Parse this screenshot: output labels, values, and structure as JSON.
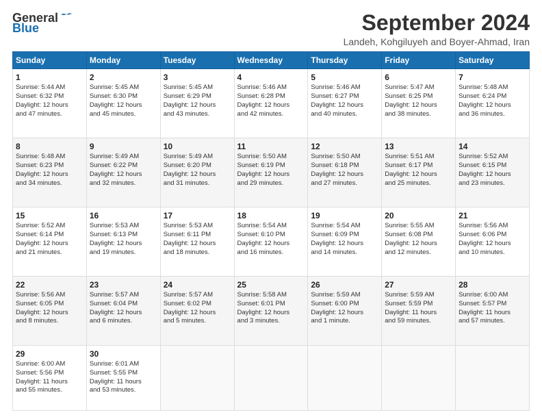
{
  "header": {
    "logo_line1": "General",
    "logo_line2": "Blue",
    "month": "September 2024",
    "location": "Landeh, Kohgiluyeh and Boyer-Ahmad, Iran"
  },
  "weekdays": [
    "Sunday",
    "Monday",
    "Tuesday",
    "Wednesday",
    "Thursday",
    "Friday",
    "Saturday"
  ],
  "weeks": [
    [
      {
        "day": "1",
        "lines": [
          "Sunrise: 5:44 AM",
          "Sunset: 6:32 PM",
          "Daylight: 12 hours",
          "and 47 minutes."
        ]
      },
      {
        "day": "2",
        "lines": [
          "Sunrise: 5:45 AM",
          "Sunset: 6:30 PM",
          "Daylight: 12 hours",
          "and 45 minutes."
        ]
      },
      {
        "day": "3",
        "lines": [
          "Sunrise: 5:45 AM",
          "Sunset: 6:29 PM",
          "Daylight: 12 hours",
          "and 43 minutes."
        ]
      },
      {
        "day": "4",
        "lines": [
          "Sunrise: 5:46 AM",
          "Sunset: 6:28 PM",
          "Daylight: 12 hours",
          "and 42 minutes."
        ]
      },
      {
        "day": "5",
        "lines": [
          "Sunrise: 5:46 AM",
          "Sunset: 6:27 PM",
          "Daylight: 12 hours",
          "and 40 minutes."
        ]
      },
      {
        "day": "6",
        "lines": [
          "Sunrise: 5:47 AM",
          "Sunset: 6:25 PM",
          "Daylight: 12 hours",
          "and 38 minutes."
        ]
      },
      {
        "day": "7",
        "lines": [
          "Sunrise: 5:48 AM",
          "Sunset: 6:24 PM",
          "Daylight: 12 hours",
          "and 36 minutes."
        ]
      }
    ],
    [
      {
        "day": "8",
        "lines": [
          "Sunrise: 5:48 AM",
          "Sunset: 6:23 PM",
          "Daylight: 12 hours",
          "and 34 minutes."
        ]
      },
      {
        "day": "9",
        "lines": [
          "Sunrise: 5:49 AM",
          "Sunset: 6:22 PM",
          "Daylight: 12 hours",
          "and 32 minutes."
        ]
      },
      {
        "day": "10",
        "lines": [
          "Sunrise: 5:49 AM",
          "Sunset: 6:20 PM",
          "Daylight: 12 hours",
          "and 31 minutes."
        ]
      },
      {
        "day": "11",
        "lines": [
          "Sunrise: 5:50 AM",
          "Sunset: 6:19 PM",
          "Daylight: 12 hours",
          "and 29 minutes."
        ]
      },
      {
        "day": "12",
        "lines": [
          "Sunrise: 5:50 AM",
          "Sunset: 6:18 PM",
          "Daylight: 12 hours",
          "and 27 minutes."
        ]
      },
      {
        "day": "13",
        "lines": [
          "Sunrise: 5:51 AM",
          "Sunset: 6:17 PM",
          "Daylight: 12 hours",
          "and 25 minutes."
        ]
      },
      {
        "day": "14",
        "lines": [
          "Sunrise: 5:52 AM",
          "Sunset: 6:15 PM",
          "Daylight: 12 hours",
          "and 23 minutes."
        ]
      }
    ],
    [
      {
        "day": "15",
        "lines": [
          "Sunrise: 5:52 AM",
          "Sunset: 6:14 PM",
          "Daylight: 12 hours",
          "and 21 minutes."
        ]
      },
      {
        "day": "16",
        "lines": [
          "Sunrise: 5:53 AM",
          "Sunset: 6:13 PM",
          "Daylight: 12 hours",
          "and 19 minutes."
        ]
      },
      {
        "day": "17",
        "lines": [
          "Sunrise: 5:53 AM",
          "Sunset: 6:11 PM",
          "Daylight: 12 hours",
          "and 18 minutes."
        ]
      },
      {
        "day": "18",
        "lines": [
          "Sunrise: 5:54 AM",
          "Sunset: 6:10 PM",
          "Daylight: 12 hours",
          "and 16 minutes."
        ]
      },
      {
        "day": "19",
        "lines": [
          "Sunrise: 5:54 AM",
          "Sunset: 6:09 PM",
          "Daylight: 12 hours",
          "and 14 minutes."
        ]
      },
      {
        "day": "20",
        "lines": [
          "Sunrise: 5:55 AM",
          "Sunset: 6:08 PM",
          "Daylight: 12 hours",
          "and 12 minutes."
        ]
      },
      {
        "day": "21",
        "lines": [
          "Sunrise: 5:56 AM",
          "Sunset: 6:06 PM",
          "Daylight: 12 hours",
          "and 10 minutes."
        ]
      }
    ],
    [
      {
        "day": "22",
        "lines": [
          "Sunrise: 5:56 AM",
          "Sunset: 6:05 PM",
          "Daylight: 12 hours",
          "and 8 minutes."
        ]
      },
      {
        "day": "23",
        "lines": [
          "Sunrise: 5:57 AM",
          "Sunset: 6:04 PM",
          "Daylight: 12 hours",
          "and 6 minutes."
        ]
      },
      {
        "day": "24",
        "lines": [
          "Sunrise: 5:57 AM",
          "Sunset: 6:02 PM",
          "Daylight: 12 hours",
          "and 5 minutes."
        ]
      },
      {
        "day": "25",
        "lines": [
          "Sunrise: 5:58 AM",
          "Sunset: 6:01 PM",
          "Daylight: 12 hours",
          "and 3 minutes."
        ]
      },
      {
        "day": "26",
        "lines": [
          "Sunrise: 5:59 AM",
          "Sunset: 6:00 PM",
          "Daylight: 12 hours",
          "and 1 minute."
        ]
      },
      {
        "day": "27",
        "lines": [
          "Sunrise: 5:59 AM",
          "Sunset: 5:59 PM",
          "Daylight: 11 hours",
          "and 59 minutes."
        ]
      },
      {
        "day": "28",
        "lines": [
          "Sunrise: 6:00 AM",
          "Sunset: 5:57 PM",
          "Daylight: 11 hours",
          "and 57 minutes."
        ]
      }
    ],
    [
      {
        "day": "29",
        "lines": [
          "Sunrise: 6:00 AM",
          "Sunset: 5:56 PM",
          "Daylight: 11 hours",
          "and 55 minutes."
        ]
      },
      {
        "day": "30",
        "lines": [
          "Sunrise: 6:01 AM",
          "Sunset: 5:55 PM",
          "Daylight: 11 hours",
          "and 53 minutes."
        ]
      },
      null,
      null,
      null,
      null,
      null
    ]
  ]
}
